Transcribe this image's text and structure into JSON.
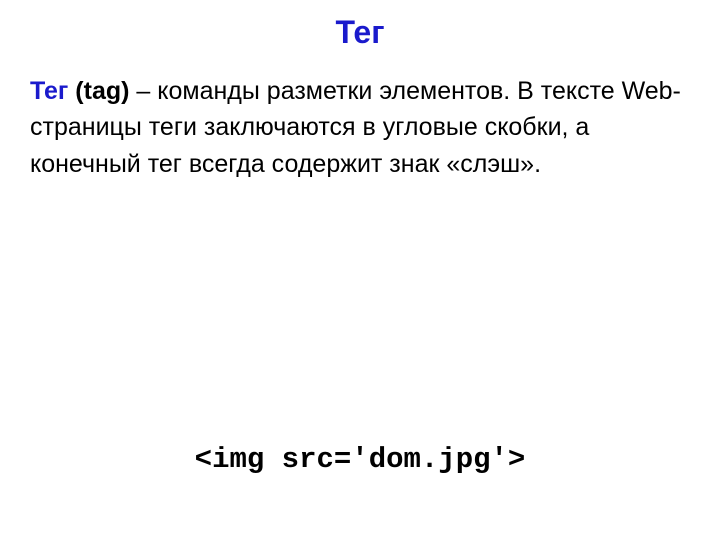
{
  "title": "Тег",
  "definition": {
    "term": "Тег",
    "term_en": "(tag)",
    "dash": " – ",
    "rest": "команды разметки элементов. В тексте Web-страницы теги заключаются в угловые скобки, а конечный тег всегда содержит знак «слэш»."
  },
  "code_example": "<img src='dom.jpg'>"
}
